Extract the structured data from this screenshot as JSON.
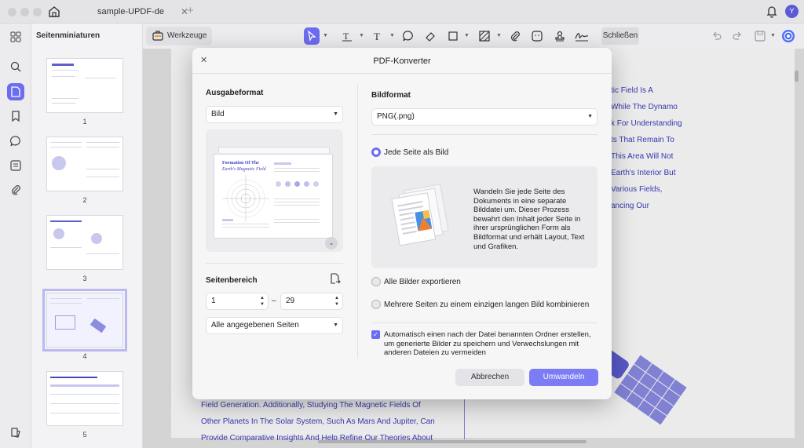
{
  "window": {
    "tab_title": "sample-UPDF-de",
    "avatar_initial": "Y"
  },
  "sidebar": {
    "title": "Seitenminiaturen",
    "pages": [
      "1",
      "2",
      "3",
      "4",
      "5"
    ]
  },
  "toolbar": {
    "tools_label": "Werkzeuge",
    "close_label": "Schließen"
  },
  "document": {
    "right_lines": [
      "tic Field Is A",
      "While The Dynamo",
      "k For Understanding",
      "ts That Remain To",
      "This Area Will Not",
      "Earth's Interior But",
      "Various Fields,",
      "ancing Our"
    ],
    "bottom_lines": [
      "Field Generation. Additionally, Studying The Magnetic Fields Of",
      "Other Planets In The Solar System, Such As Mars And Jupiter, Can",
      "Provide Comparative Insights And Help Refine Our Theories About"
    ]
  },
  "dialog": {
    "title": "PDF-Konverter",
    "output_format_label": "Ausgabeformat",
    "output_format_value": "Bild",
    "preview_title": "Formation Of The",
    "preview_subtitle": "Earth's Magnetic Field",
    "page_range_label": "Seitenbereich",
    "range_from": "1",
    "range_dash": "–",
    "range_to": "29",
    "range_mode": "Alle angegebenen Seiten",
    "image_format_label": "Bildformat",
    "image_format_value": "PNG(.png)",
    "option_each_page": "Jede Seite als Bild",
    "info_text": "Wandeln Sie jede Seite des Dokuments in eine separate Bilddatei um. Dieser Prozess bewahrt den Inhalt jeder Seite in ihrer ursprünglichen Form als Bildformat und erhält Layout, Text und Grafiken.",
    "option_all_images": "Alle Bilder exportieren",
    "option_combine": "Mehrere Seiten zu einem einzigen langen Bild kombinieren",
    "auto_folder_text": "Automatisch einen nach der Datei benannten Ordner erstellen, um generierte Bilder zu speichern und Verwechslungen mit anderen Dateien zu vermeiden",
    "cancel_label": "Abbrechen",
    "convert_label": "Umwandeln"
  },
  "colors": {
    "accent": "#6c6cf0",
    "doc_text": "#3d3dbf"
  }
}
